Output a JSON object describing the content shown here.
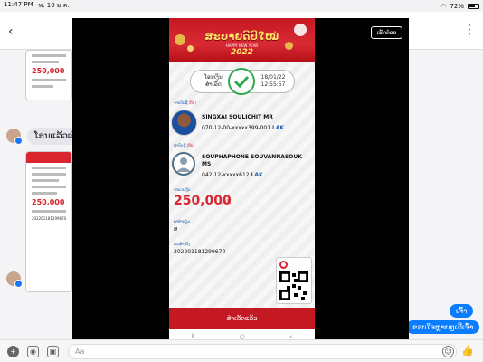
{
  "status_bar": {
    "time": "11:47 PM",
    "date": "พ. 19 ม.ค.",
    "battery": "72%",
    "battery_level": 0.72
  },
  "chat": {
    "message_left": "ໂອນແລ້ວເດີ",
    "message_right_1": "ເຈົ້າ",
    "message_right_2": "ຂອບໃຈຫຼາຍໆເດີເຈົ້າ",
    "thumb_amount": "250,000",
    "thumb_ref": "202201181299670"
  },
  "viewer": {
    "share_label": "ເຮັດຕໍ່ອອ"
  },
  "receipt": {
    "banner_title": "ສະບາຍດີປີໃໝ່",
    "banner_sub": "HAPPY NEW YEAR",
    "banner_year": "2022",
    "status_line1": "ໂອນເງິນ",
    "status_line2": "ສຳເລັດ",
    "date": "18/01/22",
    "time": "12:55:57",
    "sender_label": "ຈາກບັນຊີ",
    "sender_label_suffix": "(ກິບ)",
    "sender_name": "SINGXAI SOULICHIT MR",
    "sender_account": "070-12-00-xxxxx399-001",
    "sender_currency": "LAK",
    "receiver_label": "ຫາບັນຊີ",
    "receiver_label_suffix": "(ກິບ)",
    "receiver_name_1": "SOUPHAPHONE SOUVANNASOUK",
    "receiver_name_2": "MS",
    "receiver_account": "042-12-xxxxx612",
    "receiver_currency": "LAK",
    "amount_label": "ຈຳນວນເງິນ",
    "amount": "250,000",
    "amount_currency": "LAK",
    "fee_label": "ຄ່າທຳນຽມ",
    "fee_value": "ສ",
    "ref_label": "ເລກອ້າງອີງ",
    "ref_value": "202201181299670",
    "bottom_button": "ສຳເລັດແລ້ວ"
  },
  "composer": {
    "placeholder": "Aa"
  },
  "colors": {
    "brand_red": "#c41822",
    "success_green": "#2fa84f",
    "messenger_blue": "#0a7cff"
  }
}
